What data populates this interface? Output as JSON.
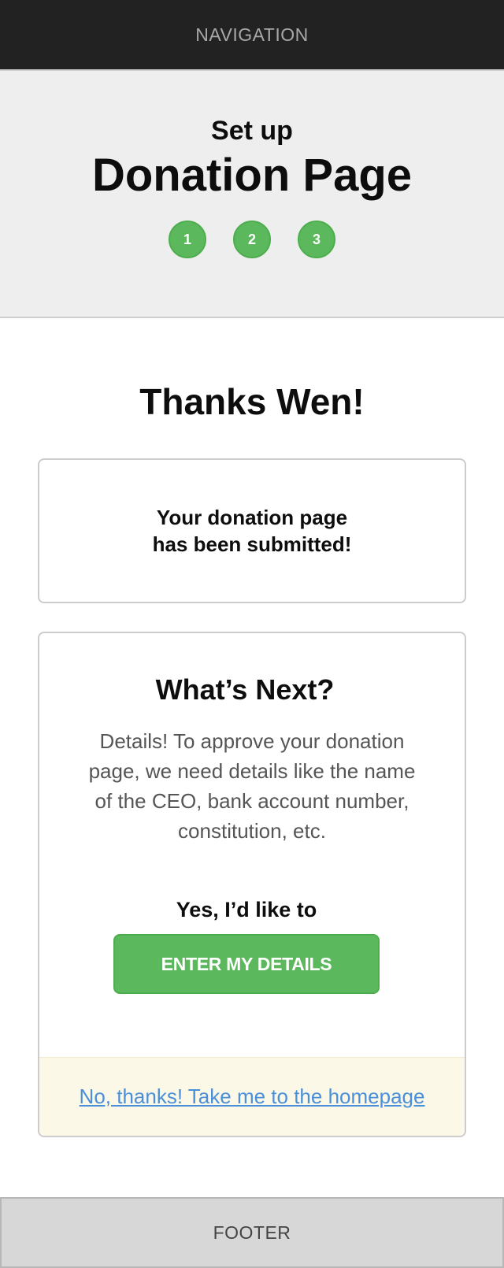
{
  "nav": {
    "label": "NAVIGATION"
  },
  "header": {
    "subtitle": "Set up",
    "title": "Donation Page",
    "steps": [
      "1",
      "2",
      "3"
    ],
    "step_color": "#5cb85c"
  },
  "main": {
    "thanks": "Thanks Wen!",
    "submitted": {
      "line1": "Your donation page",
      "line2": "has been submitted!"
    },
    "next": {
      "title": "What’s Next?",
      "description": "Details! To approve your donation page, we need details like the name of the CEO, bank account number, constitution, etc.",
      "yes_label": "Yes, I’d like to",
      "button_label": "ENTER MY DETAILS",
      "decline_link": "No, thanks! Take me to the homepage"
    }
  },
  "footer": {
    "label": "FOOTER"
  },
  "colors": {
    "accent_green": "#5cb85c",
    "link_blue": "#4a8fd9",
    "nav_bg": "#222222",
    "header_bg": "#eeeeee",
    "decline_bg": "#fcf8e8"
  }
}
